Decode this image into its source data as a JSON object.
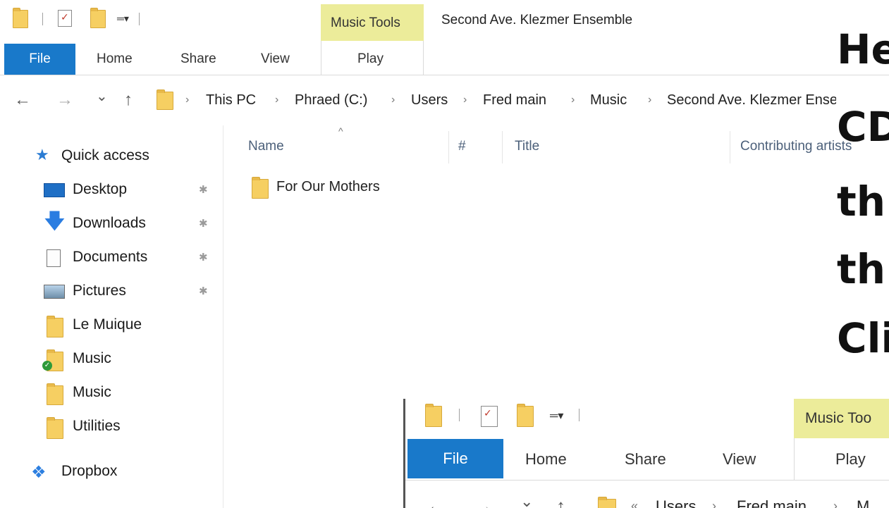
{
  "window": {
    "title": "Second Ave. Klezmer Ensemble",
    "context_group": "Music Tools"
  },
  "ribbon": {
    "tabs": [
      "File",
      "Home",
      "Share",
      "View",
      "Play"
    ]
  },
  "address": {
    "back": "←",
    "forward": "→",
    "recent": "⌄",
    "up": "↑",
    "crumbs": [
      "This PC",
      "Phraed (C:)",
      "Users",
      "Fred main",
      "Music",
      "Second Ave. Klezmer Ensemble"
    ]
  },
  "columns": {
    "sort_indicator": "^",
    "headers": [
      "Name",
      "#",
      "Title",
      "Contributing artists"
    ]
  },
  "sidebar": {
    "items": [
      {
        "label": "Quick access",
        "icon": "star-icon"
      },
      {
        "label": "Desktop",
        "icon": "desktop-icon",
        "pinned": true
      },
      {
        "label": "Downloads",
        "icon": "download-arrow-icon",
        "pinned": true
      },
      {
        "label": "Documents",
        "icon": "document-icon",
        "pinned": true
      },
      {
        "label": "Pictures",
        "icon": "picture-icon",
        "pinned": true
      },
      {
        "label": "Le Muique",
        "icon": "folder-icon"
      },
      {
        "label": "Music",
        "icon": "folder-check-icon"
      },
      {
        "label": "Music",
        "icon": "folder-icon"
      },
      {
        "label": "Utilities",
        "icon": "folder-icon"
      },
      {
        "label": "Dropbox",
        "icon": "dropbox-icon"
      }
    ]
  },
  "files": [
    {
      "name": "For Our Mothers",
      "icon": "folder-icon"
    }
  ],
  "overlay_text": [
    "He",
    "CD",
    "th",
    "th",
    "Cli"
  ],
  "inset": {
    "context_group": "Music Too",
    "tabs": [
      "File",
      "Home",
      "Share",
      "View",
      "Play"
    ],
    "crumbs_partial": [
      "Users",
      "Fred main",
      "M"
    ]
  },
  "colors": {
    "file_tab": "#1979ca",
    "context_tab": "#ecec9a",
    "folder": "#f6cf62",
    "header_text": "#4c607a"
  }
}
